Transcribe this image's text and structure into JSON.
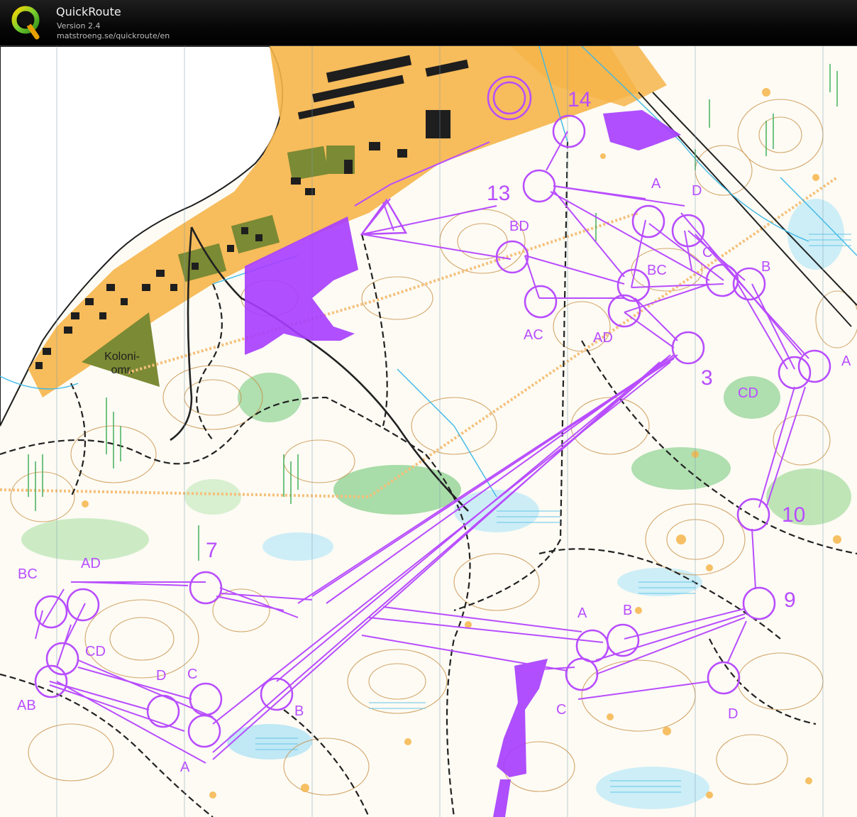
{
  "app": {
    "title": "QuickRoute",
    "version": "Version 2.4",
    "url": "matstroeng.se/quickroute/en"
  },
  "colors": {
    "course_purple": "#b84dff",
    "forbidden_area": "#a63cff",
    "map_background": "#fdfbf4",
    "water_lake": "#ffffff",
    "settlement_orange": "#f6b54a",
    "building_olive": "#7b8a34",
    "contour_brown": "#c68a3c",
    "vegetation_green": "#7fd08a",
    "marsh_blue": "#64c6e8",
    "path_black": "#222222",
    "power_line_orange": "#f5c07a"
  },
  "map": {
    "area_label_line1": "Koloni-",
    "area_label_line2": "omr.",
    "control_numbers": [
      "14",
      "13",
      "3",
      "10",
      "9",
      "7"
    ],
    "fork_labels": {
      "a_top": "A",
      "d_top": "D",
      "bd": "BD",
      "bc": "BC",
      "c_top": "C",
      "b_top": "B",
      "ac": "AC",
      "ad_mid": "AD",
      "cd_right": "CD",
      "a_right": "A",
      "bc_left": "BC",
      "ad_left": "AD",
      "cd_left": "CD",
      "ab_left": "AB",
      "d_left": "D",
      "c_left": "C",
      "b_left": "B",
      "a_bottom": "A",
      "a_mid": "A",
      "b_mid": "B",
      "c_mid": "C",
      "d_right": "D"
    }
  }
}
